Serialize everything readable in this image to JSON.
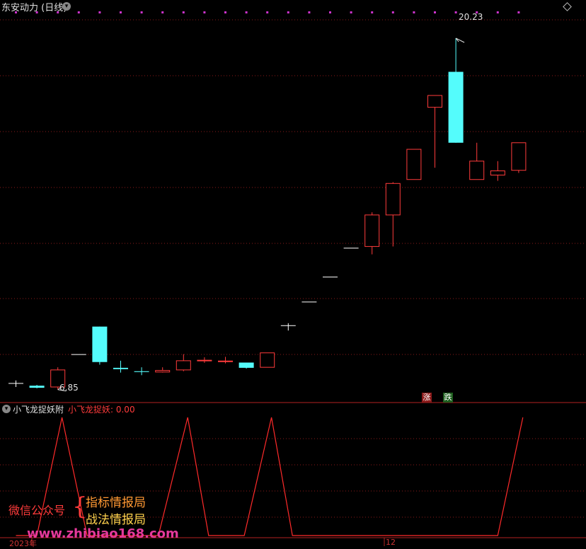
{
  "header": {
    "title": "东安动力 (日线)",
    "menu_icon": "chevron-down-icon",
    "right_icon": "diamond-icon"
  },
  "price_panel": {
    "high_label": "20.23",
    "low_label": "6.85",
    "up_badge": "涨",
    "down_badge": "跌"
  },
  "indicator_panel": {
    "name": "小飞龙捉妖附",
    "value_label": "小飞龙捉妖: 0.00"
  },
  "watermark": {
    "left_text": "微信公众号",
    "brace": "{",
    "line1": "指标情报局",
    "line2": "战法情报局",
    "url": "www.zhibiao168.com"
  },
  "x_axis": {
    "year_label": "2023年",
    "month_label": "12"
  },
  "colors": {
    "up": "#ff3b3b",
    "down": "#54fcfc",
    "flat": "#ffffff",
    "grid": "#8b1a1a",
    "marker": "#cc33cc",
    "indicator_line": "#ff2a2a"
  },
  "chart_data": {
    "type": "candlestick",
    "price_range": [
      6.6,
      21.2
    ],
    "candles": [
      {
        "o": 7.1,
        "h": 7.2,
        "l": 6.95,
        "c": 7.1
      },
      {
        "o": 7.0,
        "h": 7.03,
        "l": 6.9,
        "c": 6.92
      },
      {
        "o": 6.95,
        "h": 7.7,
        "l": 6.85,
        "c": 7.6
      },
      {
        "o": 8.2,
        "h": 8.2,
        "l": 8.2,
        "c": 8.2
      },
      {
        "o": 9.25,
        "h": 9.25,
        "l": 7.8,
        "c": 7.9
      },
      {
        "o": 7.68,
        "h": 7.95,
        "l": 7.5,
        "c": 7.63
      },
      {
        "o": 7.55,
        "h": 7.7,
        "l": 7.4,
        "c": 7.52
      },
      {
        "o": 7.52,
        "h": 7.7,
        "l": 7.5,
        "c": 7.58
      },
      {
        "o": 7.6,
        "h": 8.2,
        "l": 7.55,
        "c": 7.95
      },
      {
        "o": 7.95,
        "h": 8.08,
        "l": 7.87,
        "c": 7.97
      },
      {
        "o": 7.92,
        "h": 8.1,
        "l": 7.85,
        "c": 7.94
      },
      {
        "o": 7.88,
        "h": 7.88,
        "l": 7.65,
        "c": 7.68
      },
      {
        "o": 7.7,
        "h": 8.25,
        "l": 7.7,
        "c": 8.25
      },
      {
        "o": 9.3,
        "h": 9.38,
        "l": 9.1,
        "c": 9.3
      },
      {
        "o": 10.2,
        "h": 10.2,
        "l": 10.2,
        "c": 10.2
      },
      {
        "o": 11.15,
        "h": 11.15,
        "l": 11.15,
        "c": 11.15
      },
      {
        "o": 12.25,
        "h": 12.25,
        "l": 12.25,
        "c": 12.25
      },
      {
        "o": 12.3,
        "h": 13.6,
        "l": 12.0,
        "c": 13.5
      },
      {
        "o": 13.5,
        "h": 14.75,
        "l": 12.3,
        "c": 14.7
      },
      {
        "o": 14.85,
        "h": 16.0,
        "l": 14.85,
        "c": 16.0
      },
      {
        "o": 17.6,
        "h": 18.05,
        "l": 15.3,
        "c": 18.05
      },
      {
        "o": 18.95,
        "h": 20.23,
        "l": 16.25,
        "c": 16.25
      },
      {
        "o": 14.85,
        "h": 16.25,
        "l": 14.85,
        "c": 15.55
      },
      {
        "o": 15.02,
        "h": 15.55,
        "l": 14.8,
        "c": 15.18
      },
      {
        "o": 15.2,
        "h": 16.25,
        "l": 15.1,
        "c": 16.25
      }
    ],
    "indicator": {
      "name": "小飞龙捉妖",
      "range": [
        0,
        1
      ],
      "points": [
        {
          "i": 0,
          "v": 0.0
        },
        {
          "i": 1.0,
          "v": 0.0
        },
        {
          "i": 2.2,
          "v": 1.0
        },
        {
          "i": 3.4,
          "v": 0.0
        },
        {
          "i": 6.8,
          "v": 0.0
        },
        {
          "i": 8.2,
          "v": 1.0
        },
        {
          "i": 9.2,
          "v": 0.0
        },
        {
          "i": 10.9,
          "v": 0.0
        },
        {
          "i": 12.2,
          "v": 1.0
        },
        {
          "i": 13.2,
          "v": 0.0
        },
        {
          "i": 23.0,
          "v": 0.0
        },
        {
          "i": 24.2,
          "v": 1.0
        }
      ]
    }
  }
}
